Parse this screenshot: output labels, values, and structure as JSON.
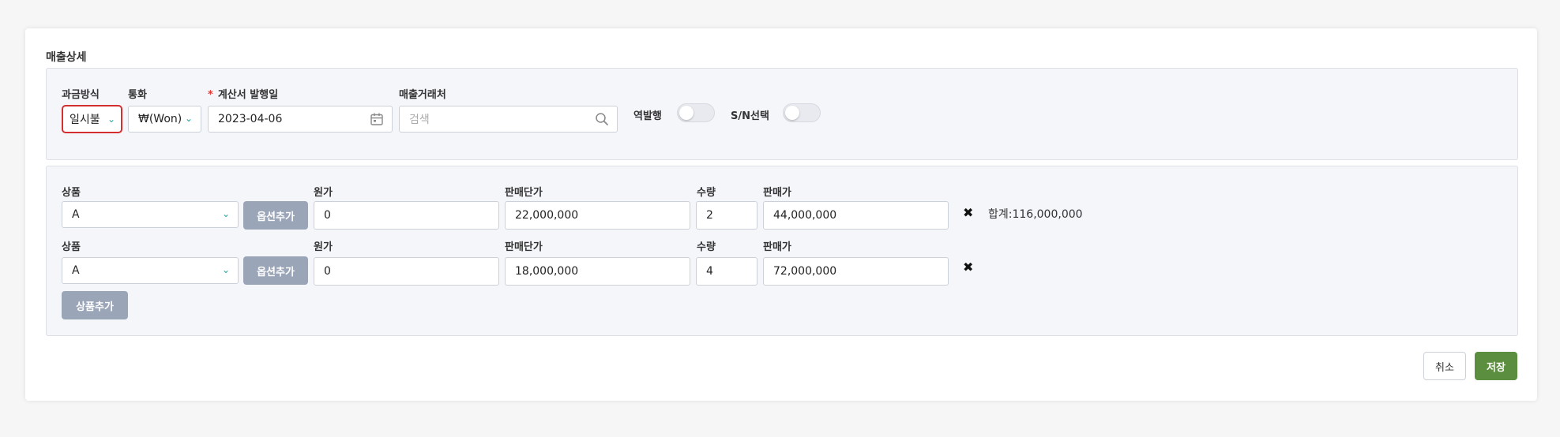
{
  "section_title": "매출상세",
  "header": {
    "billing_method": {
      "label": "과금방식",
      "value": "일시불"
    },
    "currency": {
      "label": "통화",
      "value": "₩(Won)"
    },
    "issue_date": {
      "required_mark": "*",
      "label": "계산서 발행일",
      "value": "2023-04-06"
    },
    "customer": {
      "label": "매출거래처",
      "placeholder": "검색"
    },
    "reverse_issue": {
      "label": "역발행",
      "on": false
    },
    "sn_select": {
      "label": "S/N선택",
      "on": false
    }
  },
  "items": [
    {
      "product_label": "상품",
      "product_value": "A",
      "option_button": "옵션추가",
      "cost_label": "원가",
      "cost_value": "0",
      "unit_price_label": "판매단가",
      "unit_price_value": "22,000,000",
      "qty_label": "수량",
      "qty_value": "2",
      "sale_price_label": "판매가",
      "sale_price_value": "44,000,000",
      "delete_icon": "✖"
    },
    {
      "product_label": "상품",
      "product_value": "A",
      "option_button": "옵션추가",
      "cost_label": "원가",
      "cost_value": "0",
      "unit_price_label": "판매단가",
      "unit_price_value": "18,000,000",
      "qty_label": "수량",
      "qty_value": "4",
      "sale_price_label": "판매가",
      "sale_price_value": "72,000,000",
      "delete_icon": "✖"
    }
  ],
  "total_text": "합계:116,000,000",
  "add_product_button": "상품추가",
  "footer": {
    "cancel": "취소",
    "save": "저장"
  },
  "colors": {
    "save": "#5b8f3f",
    "gray_button": "#9aa5b8",
    "highlight_border": "#d32f2f",
    "chevron": "#26a69a"
  },
  "icons": {
    "calendar": "calendar-icon",
    "search": "search-icon",
    "chevron": "chevron-down-icon",
    "delete": "close-icon"
  }
}
